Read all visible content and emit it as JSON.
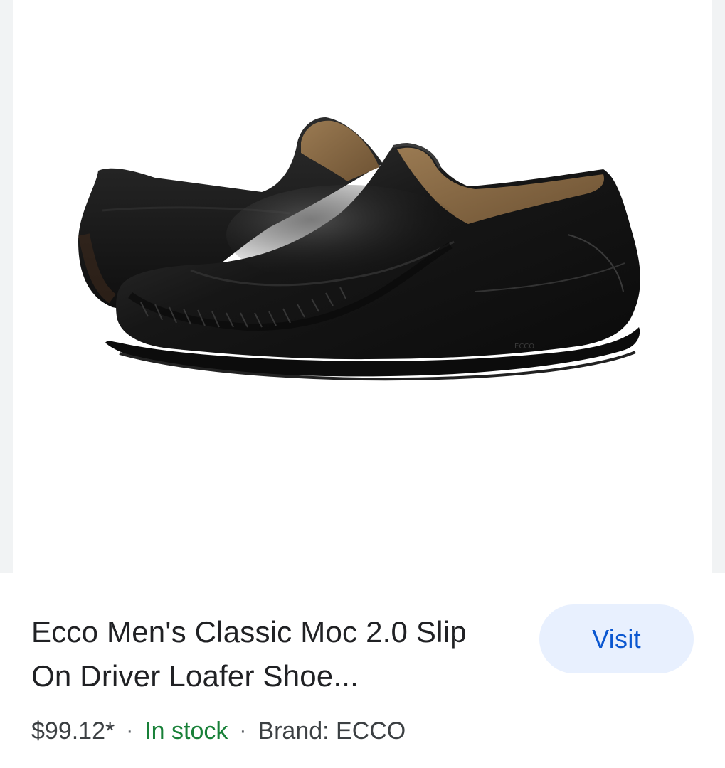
{
  "product": {
    "image_icon": "black-leather-loafer-shoes",
    "title": "Ecco Men's Classic Moc 2.0 Slip On Driver Loafer Shoe...",
    "price": "$99.12*",
    "separator": "·",
    "availability": "In stock",
    "brand": "Brand: ECCO"
  },
  "actions": {
    "visit_label": "Visit"
  },
  "colors": {
    "availability": "#188038",
    "visit_bg": "#e8f0fe",
    "visit_text": "#0b57d0",
    "title_text": "#202124"
  }
}
